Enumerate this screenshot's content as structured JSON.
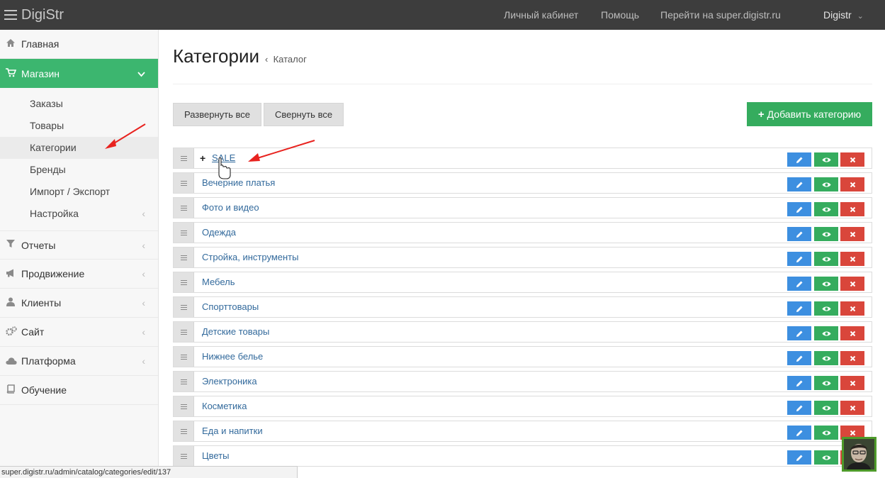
{
  "app": {
    "brand": "DigiStr"
  },
  "topnav": {
    "items": [
      "Личный кабинет",
      "Помощь",
      "Перейти на super.digistr.ru"
    ],
    "user": "Digistr"
  },
  "sidebar": {
    "home": "Главная",
    "shop": "Магазин",
    "shop_sub": [
      "Заказы",
      "Товары",
      "Категории",
      "Бренды",
      "Импорт / Экспорт",
      "Настройка"
    ],
    "reports": "Отчеты",
    "promo": "Продвижение",
    "clients": "Клиенты",
    "site": "Сайт",
    "platform": "Платформа",
    "learning": "Обучение"
  },
  "main": {
    "title": "Категории",
    "breadcrumb_sep": "‹",
    "breadcrumb": "Каталог",
    "expand_all": "Развернуть все",
    "collapse_all": "Свернуть все",
    "add_category": "Добавить категорию",
    "add_plus": "+",
    "categories": [
      {
        "name": "SALE",
        "expand": "+"
      },
      {
        "name": "Вечерние платья"
      },
      {
        "name": "Фото и видео"
      },
      {
        "name": "Одежда"
      },
      {
        "name": "Стройка, инструменты"
      },
      {
        "name": "Мебель"
      },
      {
        "name": "Спорттовары"
      },
      {
        "name": "Детские товары"
      },
      {
        "name": "Нижнее белье"
      },
      {
        "name": "Электроника"
      },
      {
        "name": "Косметика"
      },
      {
        "name": "Еда и напитки"
      },
      {
        "name": "Цветы"
      }
    ]
  },
  "statusbar": {
    "url": "super.digistr.ru/admin/catalog/categories/edit/137"
  },
  "colors": {
    "topbar": "#3d3d3d",
    "active_green": "#3cb66f",
    "add_green": "#35ac5e",
    "edit_blue": "#3d8fe0",
    "delete_red": "#d9463b",
    "link_blue": "#336a9c",
    "annotation_red": "#e8231f"
  },
  "icons": {
    "home": "home-icon",
    "shop": "cart-icon",
    "reports": "filter-icon",
    "promo": "megaphone-icon",
    "clients": "user-icon",
    "site": "cogs-icon",
    "platform": "cloud-icon",
    "learning": "book-icon",
    "edit": "pencil-icon",
    "view": "eye-icon",
    "delete": "times-icon"
  }
}
